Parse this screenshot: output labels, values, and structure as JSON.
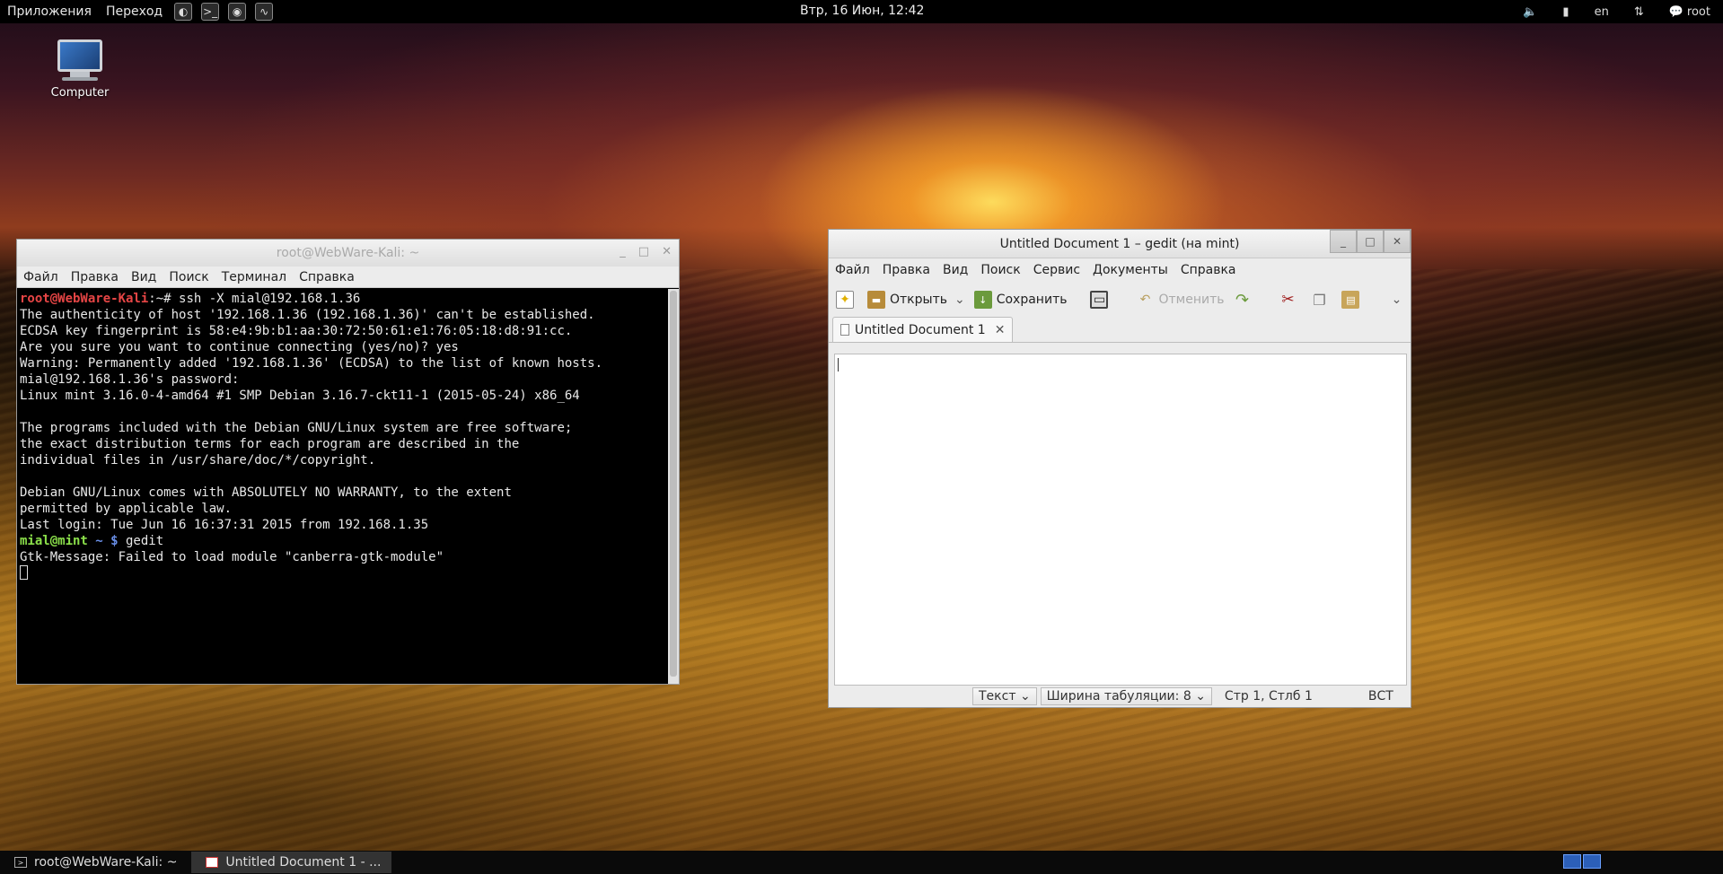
{
  "top_panel": {
    "apps_menu": "Приложения",
    "places_menu": "Переход",
    "clock": "Втр, 16 Июн, 12:42",
    "keyboard_layout": "en",
    "user": "root"
  },
  "desktop": {
    "icons": [
      {
        "label": "Computer"
      }
    ]
  },
  "terminal": {
    "title": "root@WebWare-Kali: ~",
    "menu": [
      "Файл",
      "Правка",
      "Вид",
      "Поиск",
      "Терминал",
      "Справка"
    ],
    "prompt_user_host": "root@WebWare-Kali",
    "prompt_rest": ":~# ssh -X mial@192.168.1.36",
    "lines": [
      "The authenticity of host '192.168.1.36 (192.168.1.36)' can't be established.",
      "ECDSA key fingerprint is 58:e4:9b:b1:aa:30:72:50:61:e1:76:05:18:d8:91:cc.",
      "Are you sure you want to continue connecting (yes/no)? yes",
      "Warning: Permanently added '192.168.1.36' (ECDSA) to the list of known hosts.",
      "mial@192.168.1.36's password:",
      "Linux mint 3.16.0-4-amd64 #1 SMP Debian 3.16.7-ckt11-1 (2015-05-24) x86_64",
      "",
      "The programs included with the Debian GNU/Linux system are free software;",
      "the exact distribution terms for each program are described in the",
      "individual files in /usr/share/doc/*/copyright.",
      "",
      "Debian GNU/Linux comes with ABSOLUTELY NO WARRANTY, to the extent",
      "permitted by applicable law.",
      "Last login: Tue Jun 16 16:37:31 2015 from 192.168.1.35"
    ],
    "prompt2_user_host": "mial@mint",
    "prompt2_path": " ~ $",
    "prompt2_cmd": " gedit",
    "last_line": "Gtk-Message: Failed to load module \"canberra-gtk-module\""
  },
  "gedit": {
    "title": "Untitled Document 1 – gedit (на mint)",
    "menu": [
      "Файл",
      "Правка",
      "Вид",
      "Поиск",
      "Сервис",
      "Документы",
      "Справка"
    ],
    "toolbar": {
      "open": "Открыть",
      "save": "Сохранить",
      "undo": "Отменить"
    },
    "tab_label": "Untitled Document 1",
    "status": {
      "language": "Текст",
      "tab_width": "Ширина табуляции: 8",
      "position": "Стр 1, Стлб 1",
      "mode": "ВСТ"
    }
  },
  "taskbar": {
    "tasks": [
      {
        "label": "root@WebWare-Kali: ~"
      },
      {
        "label": "Untitled Document 1 - ..."
      }
    ]
  }
}
